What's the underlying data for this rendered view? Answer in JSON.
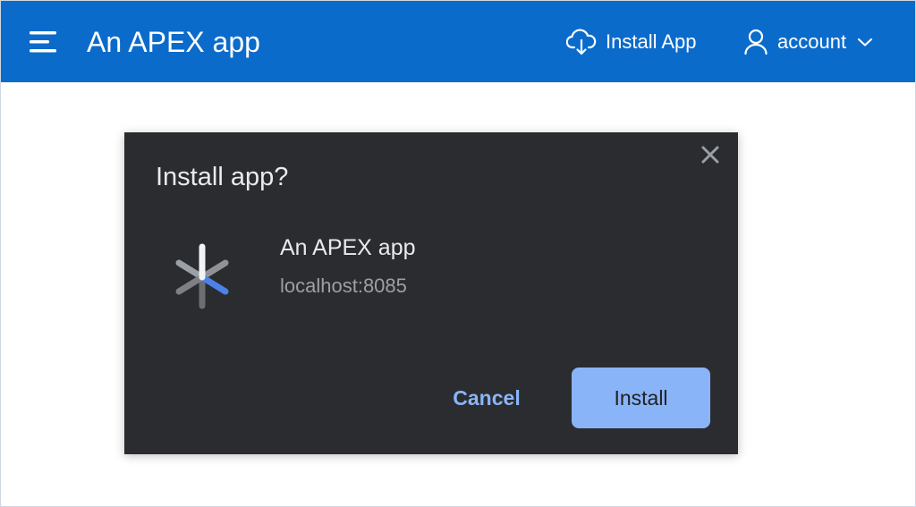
{
  "header": {
    "app_title": "An APEX app",
    "install_label": "Install App",
    "account_label": "account",
    "icons": {
      "menu": "hamburger-menu-icon",
      "install": "cloud-download-icon",
      "account": "user-icon",
      "dropdown": "chevron-down-icon"
    },
    "colors": {
      "bar": "#0b6bcb",
      "text": "#ffffff"
    }
  },
  "dialog": {
    "title": "Install app?",
    "app_name": "An APEX app",
    "app_host": "localhost:8085",
    "cancel_label": "Cancel",
    "install_label": "Install",
    "icons": {
      "close": "close-icon",
      "app": "apex-app-icon"
    },
    "colors": {
      "background": "#2b2c2f",
      "accent": "#8ab4f8",
      "secondary_text": "#9aa0a6"
    }
  }
}
